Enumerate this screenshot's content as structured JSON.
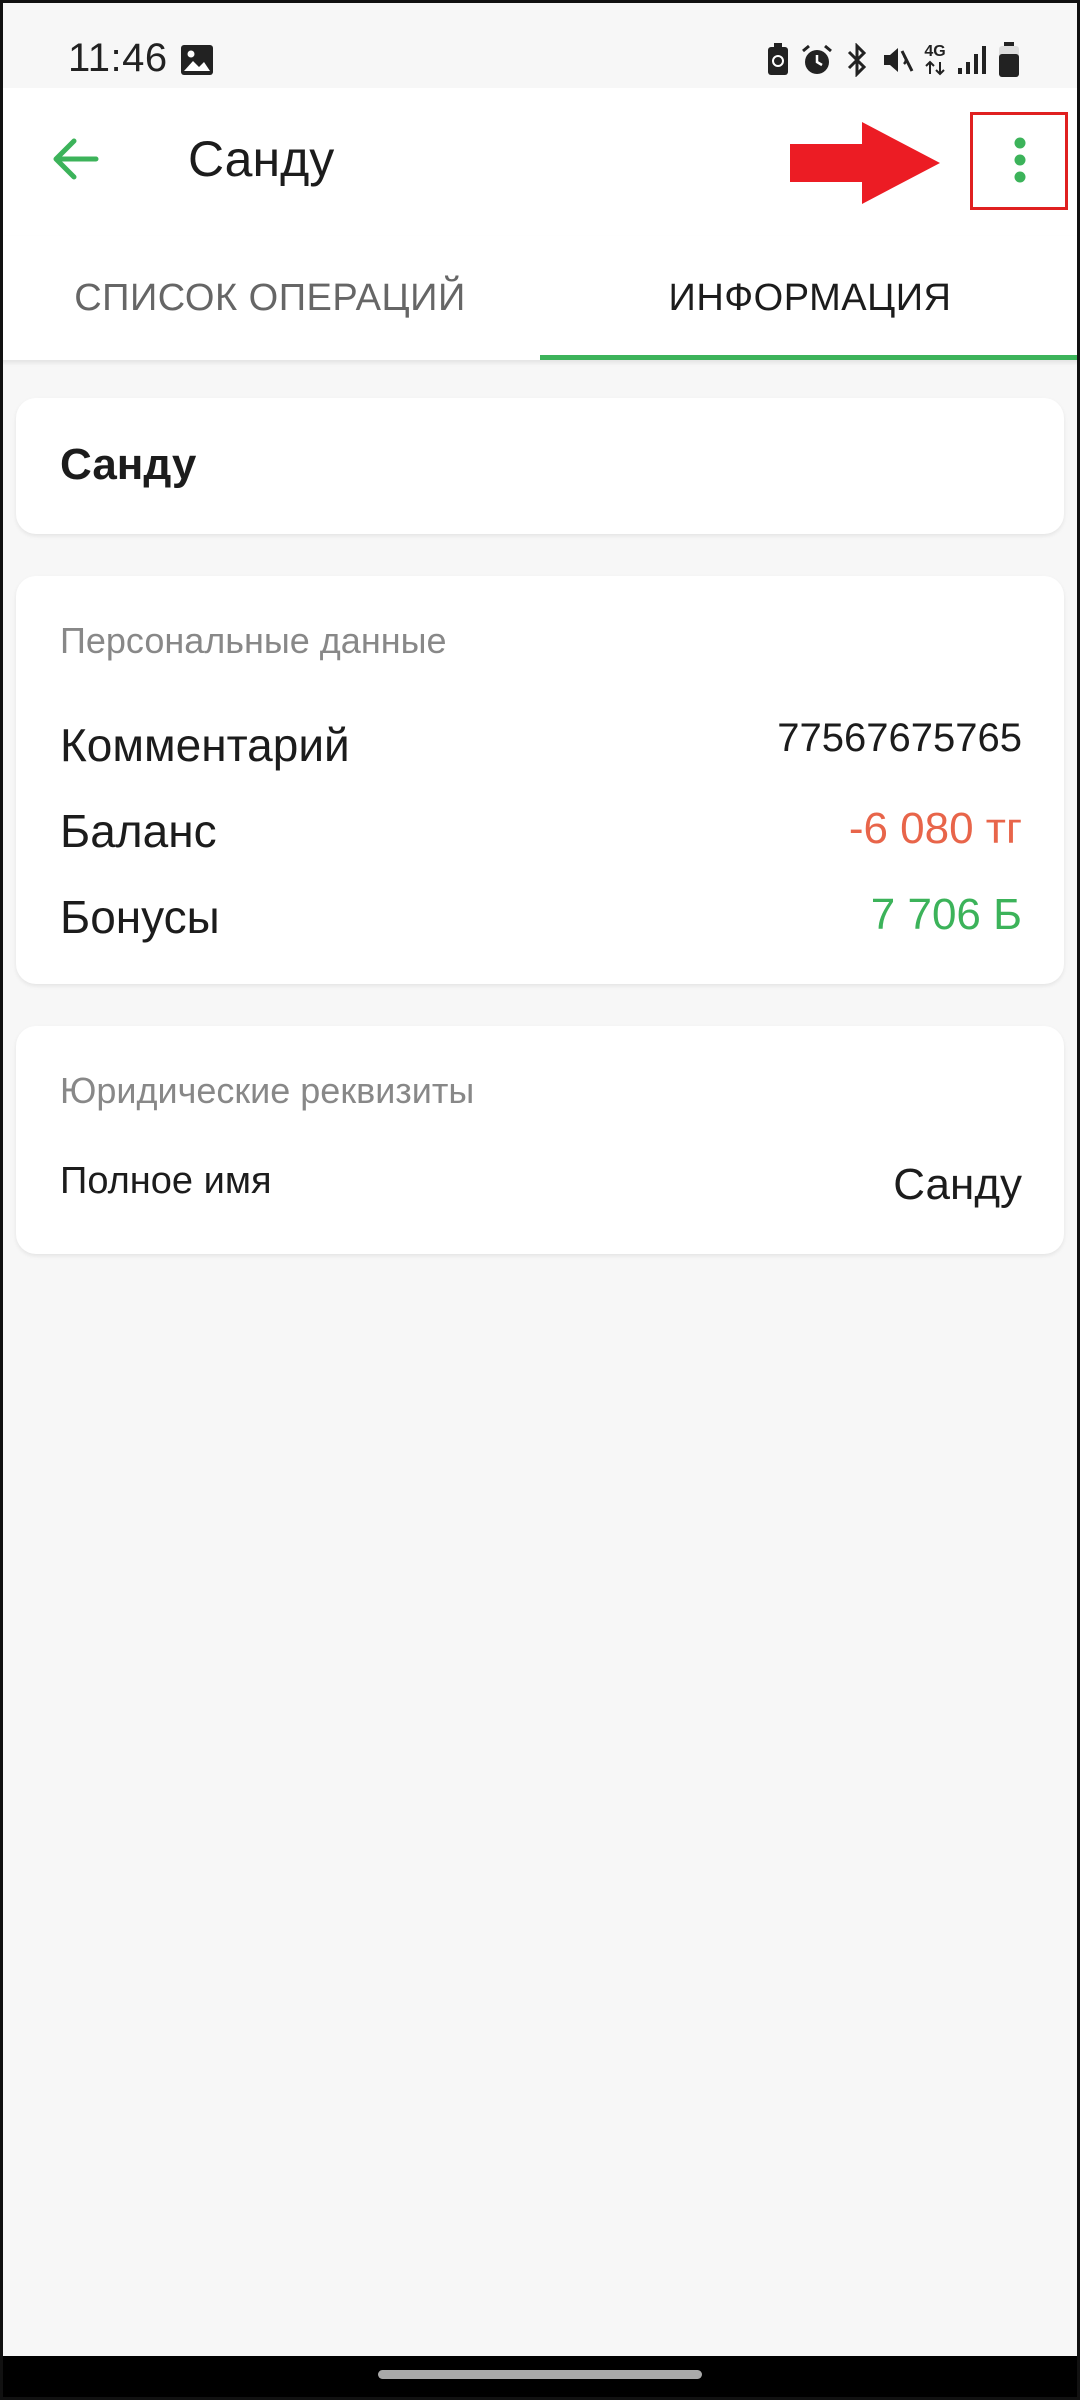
{
  "status_bar": {
    "time": "11:46",
    "icons": [
      "image-icon",
      "battery-saver-icon",
      "alarm-icon",
      "bluetooth-icon",
      "mute-icon",
      "network-4g-icon",
      "signal-icon",
      "battery-icon"
    ],
    "network_label": "4G"
  },
  "app_bar": {
    "title": "Санду",
    "back_icon": "arrow-left-icon",
    "more_icon": "more-vertical-icon"
  },
  "tabs": [
    {
      "label": "СПИСОК ОПЕРАЦИЙ",
      "active": false
    },
    {
      "label": "ИНФОРМАЦИЯ",
      "active": true
    }
  ],
  "contact": {
    "name": "Санду"
  },
  "personal": {
    "title": "Персональные данные",
    "comment_label": "Комментарий",
    "comment_value": "77567675765",
    "balance_label": "Баланс",
    "balance_value": "-6 080 тг",
    "bonus_label": "Бонусы",
    "bonus_value": "7 706 Б"
  },
  "legal": {
    "title": "Юридические реквизиты",
    "full_name_label": "Полное имя",
    "full_name_value": "Санду"
  },
  "colors": {
    "accent": "#3cb35a",
    "negative": "#e8654a",
    "positive": "#3cb35a",
    "annotation": "#e02020"
  }
}
